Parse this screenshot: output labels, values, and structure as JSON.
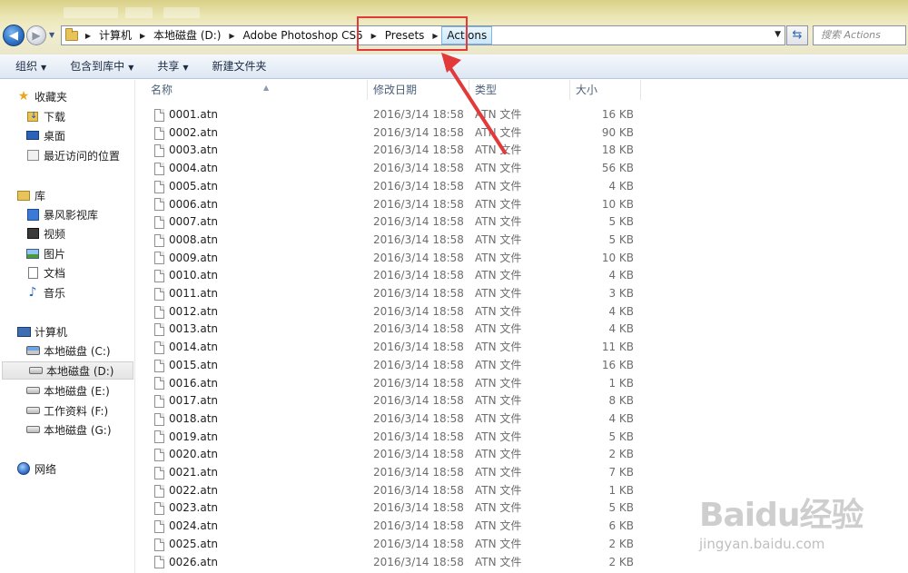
{
  "address": {
    "crumbs": [
      "计算机",
      "本地磁盘 (D:)",
      "Adobe Photoshop CS5",
      "Presets",
      "Actions"
    ],
    "search_placeholder": "搜索 Actions"
  },
  "toolbar": {
    "organize": "组织",
    "include_in_library": "包含到库中",
    "share": "共享",
    "new_folder": "新建文件夹"
  },
  "sidebar": {
    "favorites": {
      "label": "收藏夹",
      "items": [
        "下载",
        "桌面",
        "最近访问的位置"
      ]
    },
    "libraries": {
      "label": "库",
      "items": [
        "暴风影视库",
        "视频",
        "图片",
        "文档",
        "音乐"
      ]
    },
    "computer": {
      "label": "计算机",
      "items": [
        "本地磁盘 (C:)",
        "本地磁盘 (D:)",
        "本地磁盘 (E:)",
        "工作资料 (F:)",
        "本地磁盘 (G:)"
      ]
    },
    "network": {
      "label": "网络"
    }
  },
  "columns": {
    "name": "名称",
    "date": "修改日期",
    "type": "类型",
    "size": "大小"
  },
  "files": [
    {
      "name": "0001.atn",
      "date": "2016/3/14 18:58",
      "type": "ATN 文件",
      "size": "16 KB"
    },
    {
      "name": "0002.atn",
      "date": "2016/3/14 18:58",
      "type": "ATN 文件",
      "size": "90 KB"
    },
    {
      "name": "0003.atn",
      "date": "2016/3/14 18:58",
      "type": "ATN 文件",
      "size": "18 KB"
    },
    {
      "name": "0004.atn",
      "date": "2016/3/14 18:58",
      "type": "ATN 文件",
      "size": "56 KB"
    },
    {
      "name": "0005.atn",
      "date": "2016/3/14 18:58",
      "type": "ATN 文件",
      "size": "4 KB"
    },
    {
      "name": "0006.atn",
      "date": "2016/3/14 18:58",
      "type": "ATN 文件",
      "size": "10 KB"
    },
    {
      "name": "0007.atn",
      "date": "2016/3/14 18:58",
      "type": "ATN 文件",
      "size": "5 KB"
    },
    {
      "name": "0008.atn",
      "date": "2016/3/14 18:58",
      "type": "ATN 文件",
      "size": "5 KB"
    },
    {
      "name": "0009.atn",
      "date": "2016/3/14 18:58",
      "type": "ATN 文件",
      "size": "10 KB"
    },
    {
      "name": "0010.atn",
      "date": "2016/3/14 18:58",
      "type": "ATN 文件",
      "size": "4 KB"
    },
    {
      "name": "0011.atn",
      "date": "2016/3/14 18:58",
      "type": "ATN 文件",
      "size": "3 KB"
    },
    {
      "name": "0012.atn",
      "date": "2016/3/14 18:58",
      "type": "ATN 文件",
      "size": "4 KB"
    },
    {
      "name": "0013.atn",
      "date": "2016/3/14 18:58",
      "type": "ATN 文件",
      "size": "4 KB"
    },
    {
      "name": "0014.atn",
      "date": "2016/3/14 18:58",
      "type": "ATN 文件",
      "size": "11 KB"
    },
    {
      "name": "0015.atn",
      "date": "2016/3/14 18:58",
      "type": "ATN 文件",
      "size": "16 KB"
    },
    {
      "name": "0016.atn",
      "date": "2016/3/14 18:58",
      "type": "ATN 文件",
      "size": "1 KB"
    },
    {
      "name": "0017.atn",
      "date": "2016/3/14 18:58",
      "type": "ATN 文件",
      "size": "8 KB"
    },
    {
      "name": "0018.atn",
      "date": "2016/3/14 18:58",
      "type": "ATN 文件",
      "size": "4 KB"
    },
    {
      "name": "0019.atn",
      "date": "2016/3/14 18:58",
      "type": "ATN 文件",
      "size": "5 KB"
    },
    {
      "name": "0020.atn",
      "date": "2016/3/14 18:58",
      "type": "ATN 文件",
      "size": "2 KB"
    },
    {
      "name": "0021.atn",
      "date": "2016/3/14 18:58",
      "type": "ATN 文件",
      "size": "7 KB"
    },
    {
      "name": "0022.atn",
      "date": "2016/3/14 18:58",
      "type": "ATN 文件",
      "size": "1 KB"
    },
    {
      "name": "0023.atn",
      "date": "2016/3/14 18:58",
      "type": "ATN 文件",
      "size": "5 KB"
    },
    {
      "name": "0024.atn",
      "date": "2016/3/14 18:58",
      "type": "ATN 文件",
      "size": "6 KB"
    },
    {
      "name": "0025.atn",
      "date": "2016/3/14 18:58",
      "type": "ATN 文件",
      "size": "2 KB"
    },
    {
      "name": "0026.atn",
      "date": "2016/3/14 18:58",
      "type": "ATN 文件",
      "size": "2 KB"
    }
  ],
  "watermark": {
    "logo": "Baidu经验",
    "url": "jingyan.baidu.com"
  },
  "colors": {
    "annotation": "#e23a3a",
    "toolbar_text": "#1b2b44",
    "secondary_text": "#6d6d6d"
  },
  "icons": {
    "back": "back-arrow-icon",
    "forward": "forward-arrow-icon",
    "folder": "folder-icon",
    "refresh": "refresh-icon",
    "file": "file-icon"
  }
}
